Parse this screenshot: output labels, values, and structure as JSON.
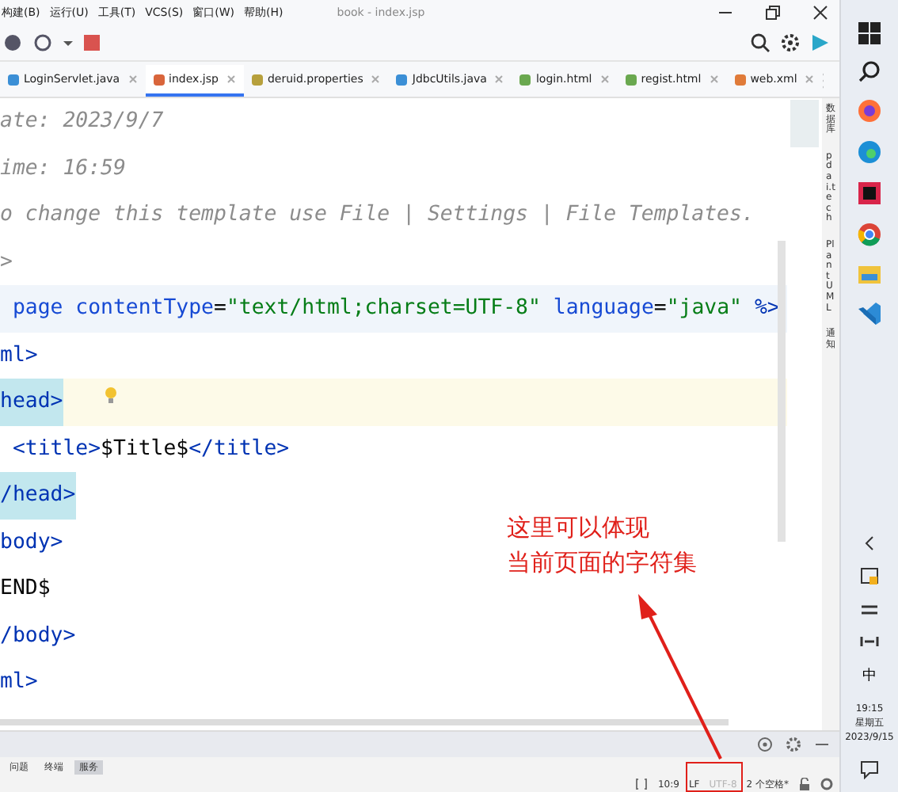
{
  "menu": {
    "items": [
      "构建(B)",
      "运行(U)",
      "工具(T)",
      "VCS(S)",
      "窗口(W)",
      "帮助(H)"
    ],
    "title": "book - index.jsp"
  },
  "tabs": [
    {
      "label": "LoginServlet.java",
      "selected": false,
      "kind": "java"
    },
    {
      "label": "index.jsp",
      "selected": true,
      "kind": "jsp"
    },
    {
      "label": "deruid.properties",
      "selected": false,
      "kind": "props"
    },
    {
      "label": "JdbcUtils.java",
      "selected": false,
      "kind": "java"
    },
    {
      "label": "login.html",
      "selected": false,
      "kind": "html"
    },
    {
      "label": "regist.html",
      "selected": false,
      "kind": "html"
    },
    {
      "label": "web.xml",
      "selected": false,
      "kind": "xml"
    }
  ],
  "editor": {
    "lines": [
      {
        "current": false,
        "marked": false,
        "segments": [
          {
            "kind": "comment",
            "text": "ate: 2023/9/7"
          }
        ]
      },
      {
        "current": false,
        "marked": false,
        "segments": [
          {
            "kind": "comment",
            "text": "ime: 16:59"
          }
        ]
      },
      {
        "current": false,
        "marked": false,
        "segments": [
          {
            "kind": "comment",
            "text": "o change this template use File | Settings | File Templates."
          }
        ]
      },
      {
        "current": false,
        "marked": false,
        "segments": [
          {
            "kind": "comment",
            "text": ">"
          }
        ]
      },
      {
        "current": false,
        "marked": true,
        "segments": [
          {
            "kind": "attr",
            "text": " page contentType"
          },
          {
            "kind": "plain",
            "text": "="
          },
          {
            "kind": "string",
            "text": "\"text/html;charset=UTF-8\""
          },
          {
            "kind": "attr",
            "text": " language"
          },
          {
            "kind": "plain",
            "text": "="
          },
          {
            "kind": "string",
            "text": "\"java\""
          },
          {
            "kind": "directive",
            "text": " %>"
          }
        ]
      },
      {
        "current": false,
        "marked": false,
        "segments": [
          {
            "kind": "tag",
            "text": "ml>"
          }
        ]
      },
      {
        "current": true,
        "marked": false,
        "segments": [
          {
            "kind": "match",
            "text": "head>"
          }
        ]
      },
      {
        "current": false,
        "marked": false,
        "segments": [
          {
            "kind": "tag",
            "text": " <title>"
          },
          {
            "kind": "plain",
            "text": "$Title$"
          },
          {
            "kind": "tag",
            "text": "</title>"
          }
        ]
      },
      {
        "current": false,
        "marked": false,
        "segments": [
          {
            "kind": "match",
            "text": "/head>"
          }
        ]
      },
      {
        "current": false,
        "marked": false,
        "segments": [
          {
            "kind": "tag",
            "text": "body>"
          }
        ]
      },
      {
        "current": false,
        "marked": false,
        "segments": [
          {
            "kind": "plain",
            "text": "END$"
          }
        ]
      },
      {
        "current": false,
        "marked": false,
        "segments": [
          {
            "kind": "tag",
            "text": "/body>"
          }
        ]
      },
      {
        "current": false,
        "marked": false,
        "segments": [
          {
            "kind": "tag",
            "text": "ml>"
          }
        ]
      }
    ]
  },
  "side_tools": [
    "数据库",
    "pdai.tech",
    "PlantUML",
    "通知"
  ],
  "annotation": {
    "lines": [
      "这里可以体现",
      "当前页面的字符集"
    ]
  },
  "bottom_tools": [
    {
      "label": "问题",
      "selected": false
    },
    {
      "label": "终端",
      "selected": false
    },
    {
      "label": "服务",
      "selected": true
    }
  ],
  "status": [
    {
      "text": "10:9",
      "dim": false
    },
    {
      "text": "LF",
      "dim": false
    },
    {
      "text": "UTF-8",
      "dim": true
    },
    {
      "text": "2 个空格*",
      "dim": false
    }
  ],
  "taskbar": {
    "ime": "中",
    "time": "19:15",
    "day": "星期五",
    "date": "2023/9/15"
  }
}
